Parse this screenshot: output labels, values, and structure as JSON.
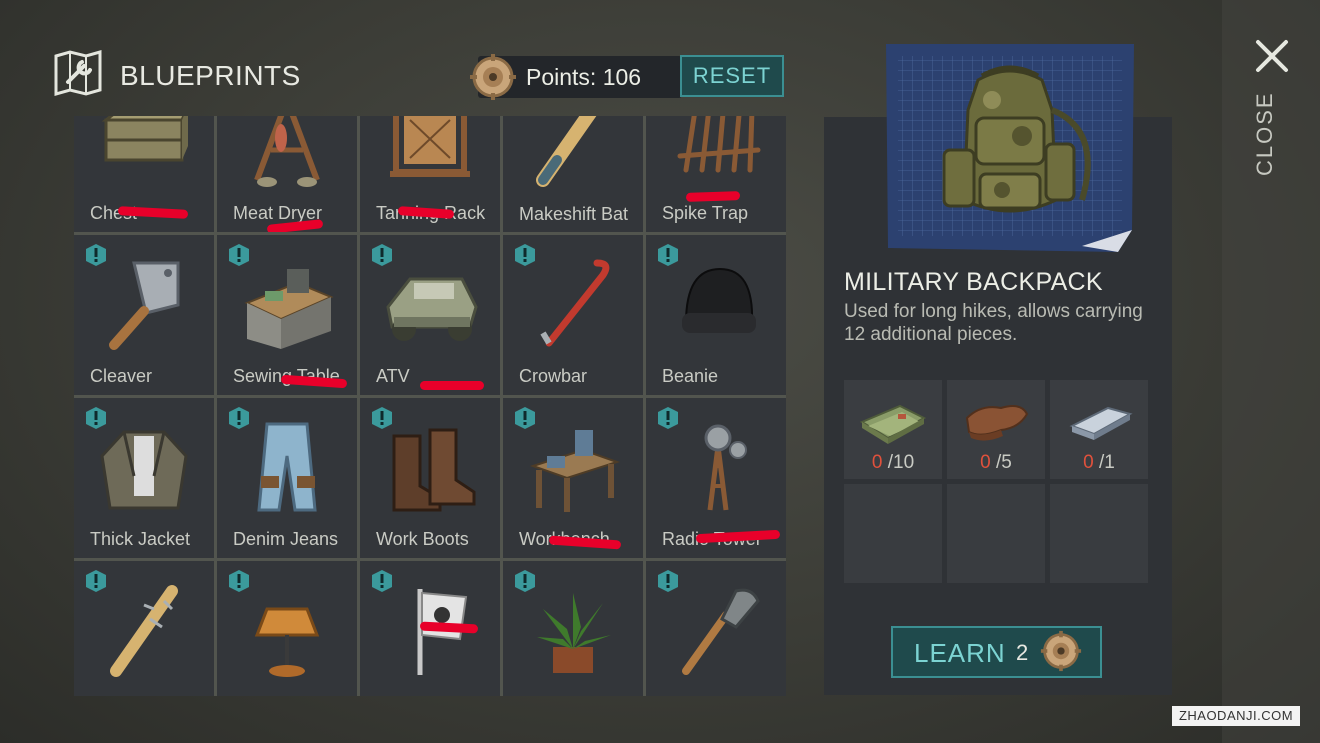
{
  "header": {
    "title": "BLUEPRINTS",
    "points_label": "Points: 106",
    "reset_label": "RESET"
  },
  "grid": {
    "items": [
      {
        "label": "Chest"
      },
      {
        "label": "Meat Dryer"
      },
      {
        "label": "Tanning Rack"
      },
      {
        "label": "Makeshift Bat"
      },
      {
        "label": "Spike Trap"
      },
      {
        "label": "Cleaver"
      },
      {
        "label": "Sewing Table"
      },
      {
        "label": "ATV"
      },
      {
        "label": "Crowbar"
      },
      {
        "label": "Beanie"
      },
      {
        "label": "Thick Jacket"
      },
      {
        "label": "Denim Jeans"
      },
      {
        "label": "Work Boots"
      },
      {
        "label": "Workbench"
      },
      {
        "label": "Radio Tower"
      },
      {
        "label": ""
      },
      {
        "label": ""
      },
      {
        "label": ""
      },
      {
        "label": ""
      },
      {
        "label": ""
      }
    ]
  },
  "detail": {
    "name": "MILITARY BACKPACK",
    "description": "Used for long hikes, allows carrying 12 additional pieces.",
    "requirements": [
      {
        "icon": "cloth-icon",
        "have": "0",
        "need": "/10"
      },
      {
        "icon": "leather-icon",
        "have": "0",
        "need": "/5"
      },
      {
        "icon": "metal-bar-icon",
        "have": "0",
        "need": "/1"
      }
    ],
    "learn_label": "LEARN",
    "learn_cost": "2"
  },
  "close_label": "CLOSE",
  "watermark": "ZHAODANJI.COM",
  "colors": {
    "accent": "#3b8f92",
    "accent_text": "#7cd3d2",
    "missing": "#e0513c",
    "marker": "#e8002a"
  }
}
